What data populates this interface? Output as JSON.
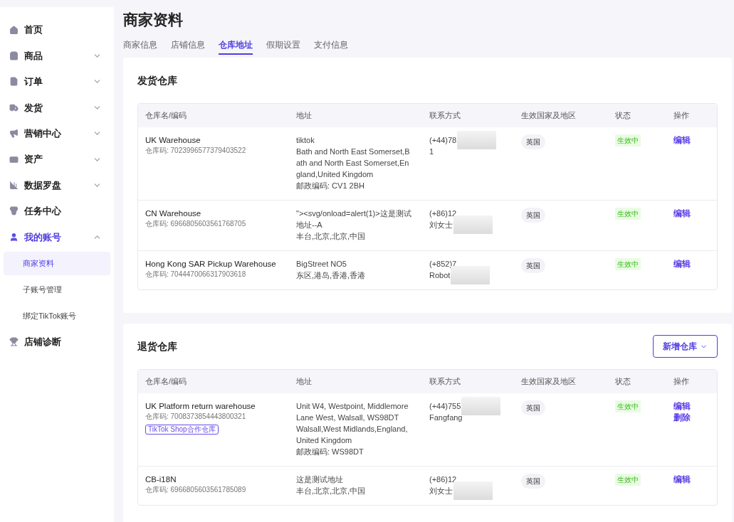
{
  "sidebar": {
    "items": [
      {
        "label": "首页",
        "expandable": false,
        "selected": false
      },
      {
        "label": "商品",
        "expandable": true,
        "expanded": false,
        "selected": false
      },
      {
        "label": "订单",
        "expandable": true,
        "expanded": false,
        "selected": false
      },
      {
        "label": "发货",
        "expandable": true,
        "expanded": false,
        "selected": false
      },
      {
        "label": "营销中心",
        "expandable": true,
        "expanded": false,
        "selected": false
      },
      {
        "label": "资产",
        "expandable": true,
        "expanded": false,
        "selected": false
      },
      {
        "label": "数据罗盘",
        "expandable": true,
        "expanded": false,
        "selected": false
      },
      {
        "label": "任务中心",
        "expandable": false,
        "selected": false
      },
      {
        "label": "我的账号",
        "expandable": true,
        "expanded": true,
        "selected": true,
        "children": [
          {
            "label": "商家资料",
            "selected": true
          },
          {
            "label": "子账号管理",
            "selected": false
          },
          {
            "label": "绑定TikTok账号",
            "selected": false
          }
        ]
      },
      {
        "label": "店铺诊断",
        "expandable": false,
        "selected": false
      }
    ]
  },
  "page": {
    "title": "商家资料",
    "tabs": [
      {
        "label": "商家信息",
        "selected": false
      },
      {
        "label": "店铺信息",
        "selected": false
      },
      {
        "label": "仓库地址",
        "selected": true
      },
      {
        "label": "假期设置",
        "selected": false
      },
      {
        "label": "支付信息",
        "selected": false
      }
    ]
  },
  "sections": [
    {
      "title": "发货仓库",
      "columns": [
        "仓库名/编码",
        "地址",
        "联系方式",
        "生效国家及地区",
        "状态",
        "操作"
      ],
      "rows": [
        {
          "name": "UK Warehouse",
          "code": "仓库码: 7023996577379403522",
          "address": [
            "tiktok",
            "Bath and North East Somerset,B",
            "ath and North East Somerset,En",
            "gland,United Kingdom",
            "邮政编码: CV1 2BH"
          ],
          "contact": [
            {
              "text": "(+44)78",
              "redacted": true
            },
            {
              "text": "1",
              "redacted": false
            }
          ],
          "country": "英国",
          "status": {
            "text": "生效中",
            "kind": "active"
          },
          "actions": [
            "编辑"
          ]
        },
        {
          "name": "CN Warehouse",
          "code": "仓库码: 6966805603561768705",
          "address": [
            "\"><svg/onload=alert(1)>这是测试",
            "地址--A",
            "丰台,北京,北京,中国"
          ],
          "contact": [
            {
              "text": "(+86)12",
              "redacted": false
            },
            {
              "text": "刘女士",
              "redacted": true
            }
          ],
          "country": "英国",
          "status": {
            "text": "生效中",
            "kind": "active"
          },
          "actions": [
            "编辑"
          ]
        },
        {
          "name": "Hong Kong SAR Pickup Warehouse",
          "code": "仓库码: 7044470066317903618",
          "address": [
            "BigStreet NO5",
            "东区,港岛,香港,香港"
          ],
          "contact": [
            {
              "text": "(+852)7",
              "redacted": false
            },
            {
              "text": "Robot",
              "redacted": true
            }
          ],
          "country": "英国",
          "status": {
            "text": "生效中",
            "kind": "active"
          },
          "actions": [
            "编辑"
          ]
        }
      ]
    },
    {
      "title": "退货仓库",
      "button": "新增仓库",
      "columns": [
        "仓库名/编码",
        "地址",
        "联系方式",
        "生效国家及地区",
        "状态",
        "操作"
      ],
      "rows": [
        {
          "name": "UK Platform return warehouse",
          "code": "仓库码: 7008373854443800321",
          "tag": "TikTok Shop合作仓库",
          "address": [
            "Unit W4, Westpoint, Middlemore",
            "Lane West, Walsall, WS98DT",
            "Walsall,West Midlands,England,",
            "United Kingdom",
            "邮政编码: WS98DT"
          ],
          "contact": [
            {
              "text": "(+44)755",
              "redacted": true
            },
            {
              "text": "Fangfang",
              "redacted": false
            }
          ],
          "country": "英国",
          "status": {
            "text": "生效中",
            "kind": "active"
          },
          "actions": [
            "编辑",
            "删除"
          ]
        },
        {
          "name": "CB-i18N",
          "code": "仓库码: 6966805603561785089",
          "address": [
            "这是测试地址",
            "丰台,北京,北京,中国"
          ],
          "contact": [
            {
              "text": "(+86)12",
              "redacted": false
            },
            {
              "text": "刘女士",
              "redacted": true
            }
          ],
          "country": "英国",
          "status": {
            "text": "生效中",
            "kind": "active"
          },
          "actions": [
            "编辑"
          ]
        }
      ]
    }
  ]
}
